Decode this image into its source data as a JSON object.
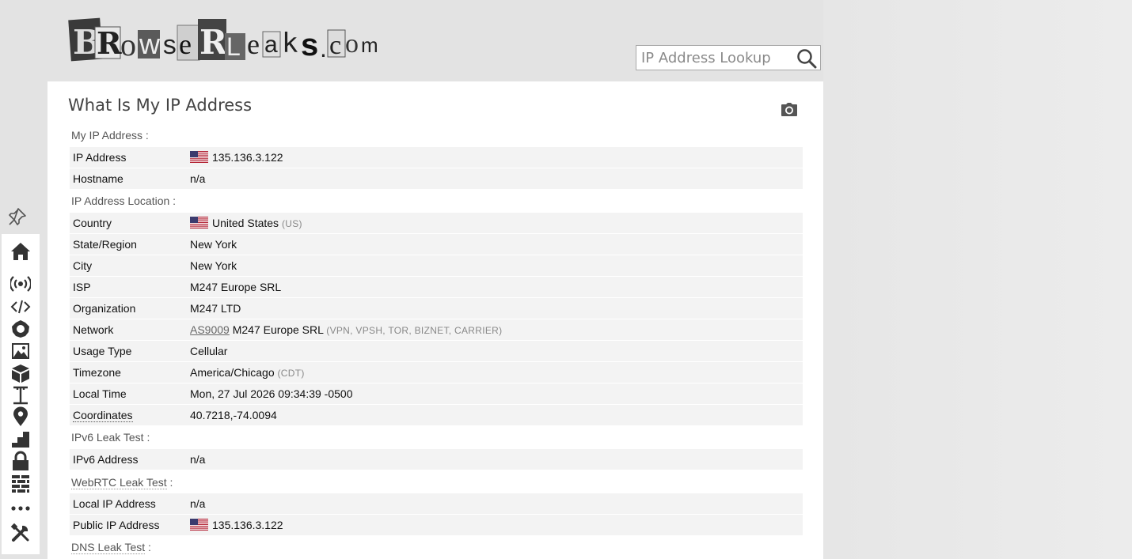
{
  "header": {
    "logo_text": "BrowserLeaks.com",
    "search": {
      "placeholder": "IP Address Lookup",
      "value": ""
    }
  },
  "sidebar": {
    "pin_icon": "pin-icon",
    "items": [
      {
        "icon": "home-icon"
      },
      {
        "icon": "broadcast-icon"
      },
      {
        "icon": "code-icon"
      },
      {
        "icon": "canvas-icon"
      },
      {
        "icon": "image-icon"
      },
      {
        "icon": "cube-icon"
      },
      {
        "icon": "font-icon"
      },
      {
        "icon": "location-pin-icon"
      },
      {
        "icon": "stairs-icon"
      },
      {
        "icon": "lock-icon"
      },
      {
        "icon": "firewall-icon"
      },
      {
        "icon": "more-icon"
      },
      {
        "icon": "tools-icon"
      }
    ]
  },
  "main": {
    "title": "What Is My IP Address",
    "sections": {
      "my_ip": "My IP Address :",
      "location": "IP Address Location :",
      "ipv6": "IPv6 Leak Test :",
      "webrtc": "WebRTC Leak Test",
      "webrtc_colon": " :",
      "dns": "DNS Leak Test",
      "dns_colon": " :"
    },
    "rows": {
      "ip_address": {
        "label": "IP Address",
        "value": "135.136.3.122"
      },
      "hostname": {
        "label": "Hostname",
        "value": "n/a"
      },
      "country": {
        "label": "Country",
        "value": "United States",
        "extra": "(US)"
      },
      "state": {
        "label": "State/Region",
        "value": "New York"
      },
      "city": {
        "label": "City",
        "value": "New York"
      },
      "isp": {
        "label": "ISP",
        "value": "M247 Europe SRL"
      },
      "organization": {
        "label": "Organization",
        "value": "M247 LTD"
      },
      "network": {
        "label": "Network",
        "link": "AS9009",
        "value": "M247 Europe SRL",
        "extra": "(VPN, VPSH, TOR, BIZNET, CARRIER)"
      },
      "usage_type": {
        "label": "Usage Type",
        "value": "Cellular"
      },
      "timezone": {
        "label": "Timezone",
        "value": "America/Chicago",
        "extra": "(CDT)"
      },
      "local_time": {
        "label": "Local Time",
        "value": "Mon, 27 Jul 2026 09:34:39 -0500"
      },
      "coordinates": {
        "label": "Coordinates",
        "value": "40.7218,-74.0094"
      },
      "ipv6_address": {
        "label": "IPv6 Address",
        "value": "n/a"
      },
      "local_ip": {
        "label": "Local IP Address",
        "value": "n/a"
      },
      "public_ip": {
        "label": "Public IP Address",
        "value": "135.136.3.122"
      }
    }
  },
  "colors": {
    "page_bg": "#e3e3e3",
    "row_bg": "#f3f3f3",
    "title": "#444444"
  }
}
